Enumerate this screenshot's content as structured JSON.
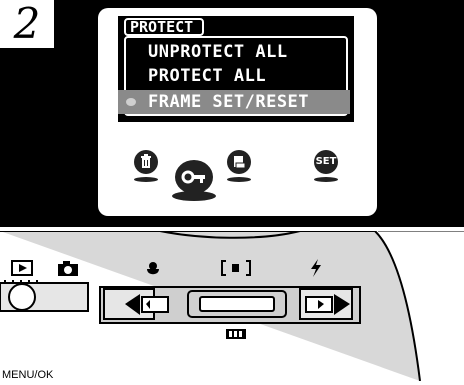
{
  "step_number": "2",
  "menu": {
    "title": "PROTECT",
    "items": [
      "UNPROTECT ALL",
      "PROTECT ALL",
      "FRAME SET/RESET"
    ],
    "selected_index": 2
  },
  "lcd_icons": [
    "trash-icon",
    "key-icon",
    "print-order-icon",
    "setup-icon"
  ],
  "lcd_icon_labels": {
    "setup": "SET"
  },
  "camera": {
    "mode_labels": [
      "playback-icon",
      "camera-icon"
    ],
    "top_icons": [
      "macro-flower-icon",
      "af-bracket-icon",
      "flash-icon"
    ],
    "bottom_label": "MENU/OK"
  }
}
